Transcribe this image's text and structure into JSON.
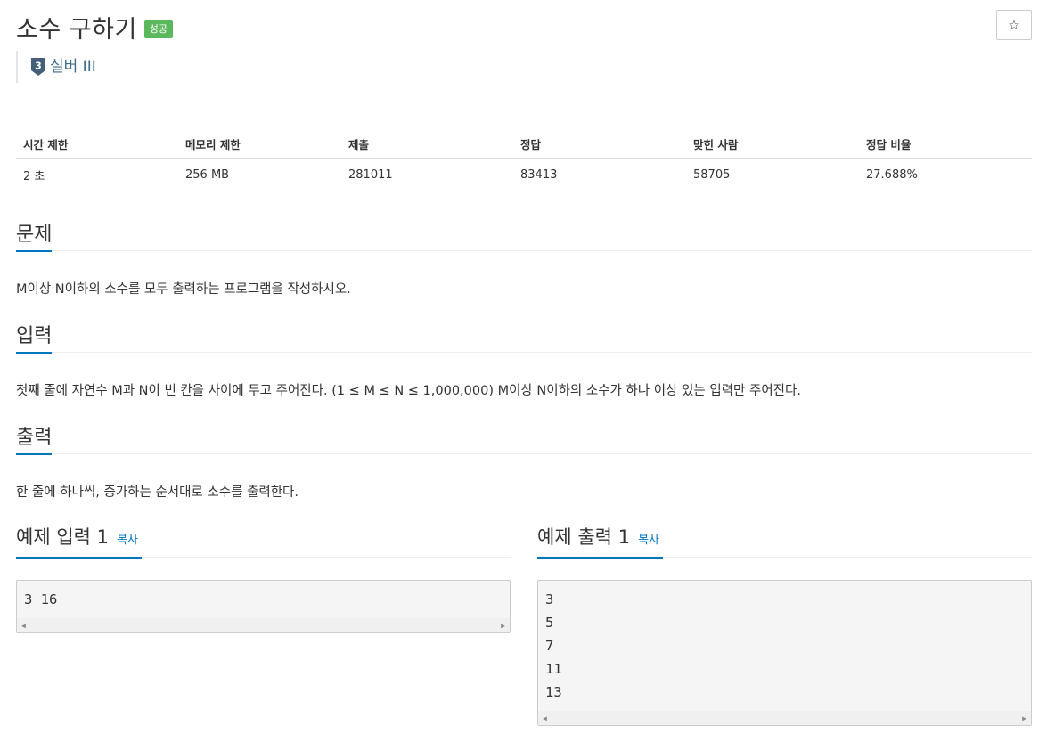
{
  "problem": {
    "title": "소수 구하기",
    "status_badge": "성공",
    "star_icon": "☆",
    "tier": {
      "level": "3",
      "label": "실버 III",
      "color": "#435f7a"
    }
  },
  "info_table": {
    "headers": [
      "시간 제한",
      "메모리 제한",
      "제출",
      "정답",
      "맞힌 사람",
      "정답 비율"
    ],
    "values": [
      "2 초",
      "256 MB",
      "281011",
      "83413",
      "58705",
      "27.688%"
    ]
  },
  "sections": {
    "problem": {
      "title": "문제",
      "text": "M이상 N이하의 소수를 모두 출력하는 프로그램을 작성하시오."
    },
    "input": {
      "title": "입력",
      "text": "첫째 줄에 자연수 M과 N이 빈 칸을 사이에 두고 주어진다. (1 ≤ M ≤ N ≤ 1,000,000) M이상 N이하의 소수가 하나 이상 있는 입력만 주어진다."
    },
    "output": {
      "title": "출력",
      "text": "한 줄에 하나씩, 증가하는 순서대로 소수를 출력한다."
    }
  },
  "examples": {
    "input": {
      "title": "예제 입력 1",
      "copy_label": "복사",
      "lines": [
        "3 16"
      ]
    },
    "output": {
      "title": "예제 출력 1",
      "copy_label": "복사",
      "lines": [
        "3",
        "5",
        "7",
        "11",
        "13"
      ]
    }
  },
  "colors": {
    "accent": "#0076c0",
    "success": "#5cb85c",
    "tier_text": "#3b6b8f"
  }
}
